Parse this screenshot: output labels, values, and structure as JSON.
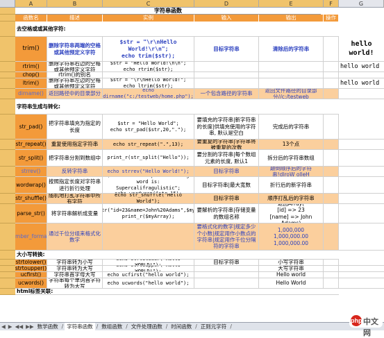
{
  "columns": [
    "A",
    "B",
    "C",
    "D",
    "E",
    "F",
    "G"
  ],
  "sheet_title": "字符串函数",
  "headers": [
    "函数名",
    "描述",
    "实例",
    "输入",
    "输出",
    "操作"
  ],
  "rows": [
    {
      "type": "section",
      "a": "去空格或或其他字符:"
    },
    {
      "type": "fn",
      "a": "trim()",
      "b": "删除字符串两端的空格或其他预定义字符",
      "c": "$str = \"\\r\\nHello World!\\r\\n\";\necho trim($str);",
      "d": "目标字符串",
      "e": "清除后的字符串",
      "f": "",
      "g": "hello world!",
      "style": "blue-bold"
    },
    {
      "type": "fn",
      "a": "rtrim()",
      "b": "删除字符串右边的空格或其他预定义字符",
      "c": "$str = \"Hello World!\\n\\n\";\necho rtrim($str);",
      "d": "",
      "e": "",
      "f": "",
      "g": "hello world"
    },
    {
      "type": "fn",
      "a": "chop()",
      "b": "rtrim()的别名",
      "c": "",
      "d": "",
      "e": "",
      "f": "",
      "g": ""
    },
    {
      "type": "fn",
      "a": "ltrim()",
      "b": "删除字符串左边的空格或其他预定义字符",
      "c": "$str = \"\\r\\nHello World!\";\necho ltrim($str);",
      "d": "",
      "e": "",
      "f": "",
      "g": "hello world"
    },
    {
      "type": "fn",
      "a": "dirname()",
      "b": "返回路径中的目录部分",
      "c": "echo dirname(\"c:/testweb/home.php\");",
      "d": "一个包含路径的字符串",
      "e": "返回文件路径的目录部分//c:/testweb",
      "f": "",
      "g": "",
      "style": "orange-alt"
    },
    {
      "type": "section",
      "a": "字符串生成与转化:"
    },
    {
      "type": "fn",
      "a": "str_pad()",
      "b": "把字符串填充为指定的长度",
      "c": "$str = \"Hello World\";\necho str_pad($str,20,\".\");",
      "d": "要填充的字符串|新字符串的长度|供填充使用的字符串, 默认是空白",
      "e": "完成后的字符串",
      "f": "",
      "g": ""
    },
    {
      "type": "fn",
      "a": "str_repeat()",
      "b": "重复使用指定字符串",
      "c": "echo str_repeat(\".\",13);",
      "d": "要重复的字符串|字符串将被重复的次数",
      "e": "13个点",
      "f": "",
      "g": "",
      "style": "orange"
    },
    {
      "type": "fn",
      "a": "str_split()",
      "b": "把字符串分割到数组中",
      "c": "print_r(str_split(\"Hello\"));",
      "d": "要分割的字符串|每个数组元素的长度, 默认1",
      "e": "拆分后的字符串数组",
      "f": "",
      "g": ""
    },
    {
      "type": "fn",
      "a": "strrev()",
      "b": "反转字符串",
      "c": "echo strrev(\"Hello World!\");",
      "d": "目标字符串",
      "e": "颠倒顺序后的字符串!dlroW olleH",
      "f": "",
      "g": "",
      "style": "orange-alt"
    },
    {
      "type": "fn",
      "a": "wordwrap()",
      "b": "按照指定长度对字符串进行折行处理",
      "c": "$str = \"An example on a long word is: Supercalifragulistic\";\necho wordwrap($str,15);",
      "d": "目标字符串|最大宽数",
      "e": "折行后的新字符串",
      "f": "",
      "g": ""
    },
    {
      "type": "fn",
      "a": "str_shuffle()",
      "b": "随机地打乱字符串中所有字符",
      "c": "echo str_shuffle(\"Hello World\");",
      "d": "目标字符串",
      "e": "顺序打乱后的字符串",
      "f": "",
      "g": "",
      "style": "orange"
    },
    {
      "type": "fn",
      "a": "parse_str()",
      "b": "将字符串解析成变量",
      "c": "parse_str(\"id=23&name=John%20Adams\",$myArray);\nprint_r($myArray);",
      "d": "要解析的字符串|存储变量的数组名称",
      "e": "返回Array(\n[id] => 23\n[name] => John Adams)",
      "f": "",
      "g": ""
    },
    {
      "type": "fn",
      "a": "number_format()",
      "b": "通过千位分组来格式化数字",
      "c": "",
      "d": "要格式化的数字|规定多少个小数|规定用作小数点的字符串|规定用作千位分隔符的字符串",
      "e": "1,000,000\n1,000,000.00\n1,000,000.00",
      "f": "",
      "g": "",
      "style": "orange-alt"
    },
    {
      "type": "section",
      "a": "大小写转换:"
    },
    {
      "type": "fn",
      "a": "strtolower()",
      "b": "字符串转为小写",
      "c": "echo strtolower(\"Hello WORLD!\");",
      "d": "目标字符串",
      "e": "小写字符串",
      "f": "",
      "g": ""
    },
    {
      "type": "fn",
      "a": "strtoupper()",
      "b": "字符串转为大写",
      "c": "echo strtoupper(\"Hello WORLD!\");",
      "d": "",
      "e": "大写字符串",
      "f": "",
      "g": ""
    },
    {
      "type": "fn",
      "a": "ucfirst()",
      "b": "字符串首字母大写",
      "c": "echo ucfirst(\"hello world\");",
      "d": "",
      "e": "Hello world",
      "f": "",
      "g": ""
    },
    {
      "type": "fn",
      "a": "ucwords()",
      "b": "字符串每个单词首字符转为大写",
      "c": "echo ucwords(\"hello world\");",
      "d": "",
      "e": "Hello World",
      "f": "",
      "g": ""
    },
    {
      "type": "section",
      "a": "html标签关联:"
    }
  ],
  "tabs": [
    "数学函数",
    "字符串函数",
    "数组函数",
    "文件处理函数",
    "时间函数",
    "正则元字符"
  ],
  "active_tab": 1,
  "tab_nav": [
    "◀",
    "▶",
    "◀◀",
    "▶▶"
  ],
  "logo": {
    "mark": "php",
    "text": "中文网"
  },
  "colors": {
    "header_orange": "#f39a3a",
    "col_a": "#f39a3a",
    "light_orange": "#fbcf9d",
    "blue_text": "#2a3fbf"
  }
}
